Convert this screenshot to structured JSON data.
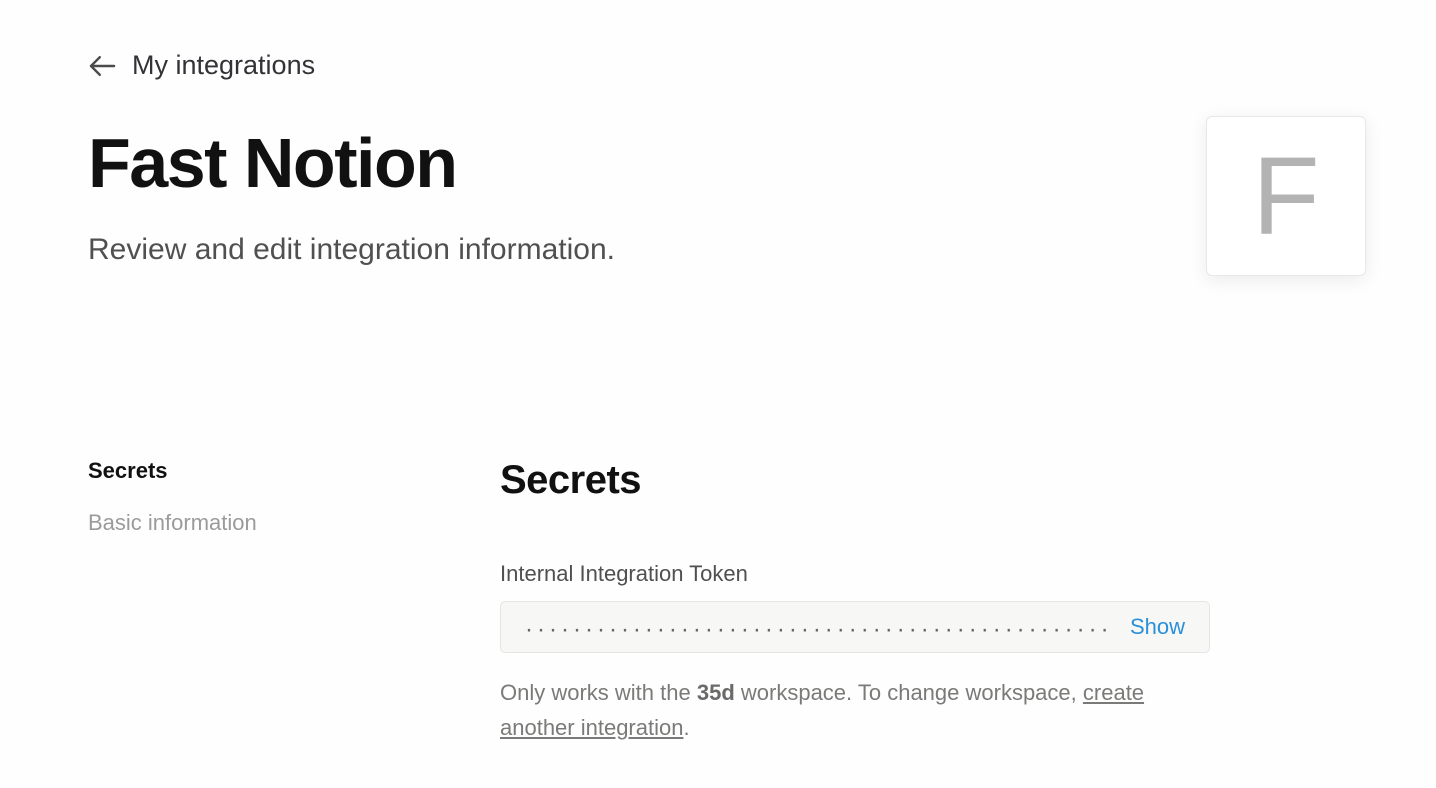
{
  "breadcrumb": {
    "label": "My integrations"
  },
  "header": {
    "title": "Fast Notion",
    "subtitle": "Review and edit integration information.",
    "logo_letter": "F"
  },
  "sidebar": {
    "items": [
      {
        "label": "Secrets",
        "active": true
      },
      {
        "label": "Basic information",
        "active": false
      }
    ]
  },
  "main": {
    "section_heading": "Secrets",
    "token": {
      "label": "Internal Integration Token",
      "masked_value": "··················································",
      "show_label": "Show"
    },
    "helper": {
      "prefix": "Only works with the ",
      "workspace": "35d",
      "middle": " workspace. To change workspace, ",
      "link_text": "create another integration",
      "suffix": "."
    }
  }
}
